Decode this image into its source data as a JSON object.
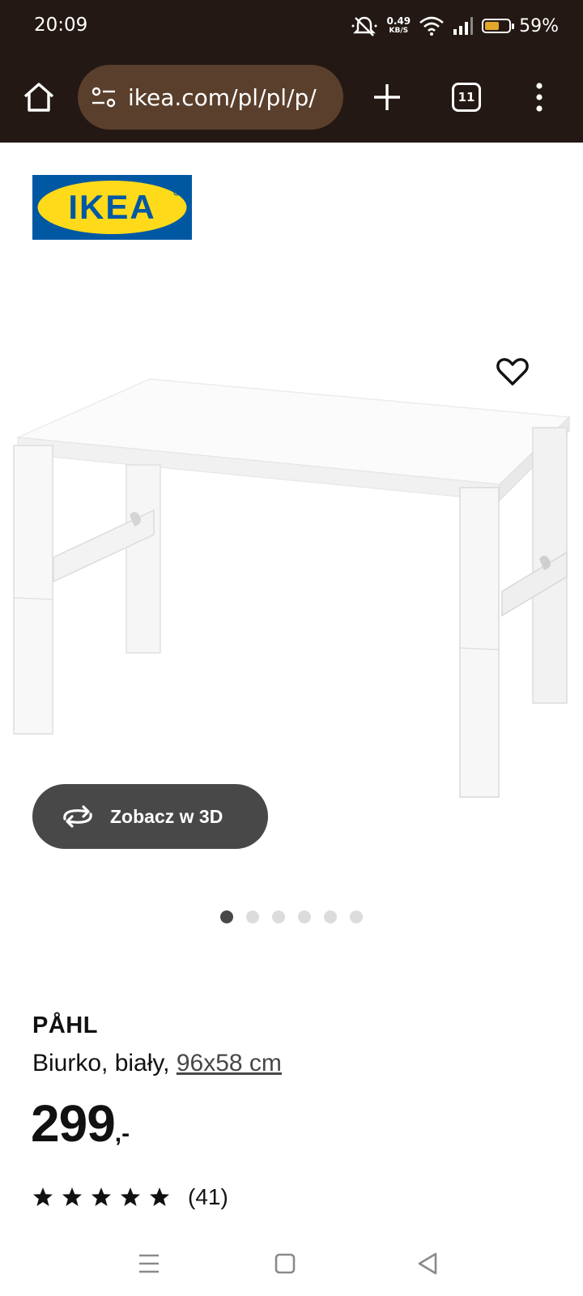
{
  "status_bar": {
    "time": "20:09",
    "net_speed_value": "0.49",
    "net_speed_unit": "KB/S",
    "battery_percent": "59%",
    "battery_level": 0.59,
    "icons": [
      "mute-icon",
      "wifi-icon",
      "signal-icon",
      "battery-icon"
    ]
  },
  "browser": {
    "url": "ikea.com/pl/pl/p/",
    "tab_count": "11",
    "icons": [
      "home-icon",
      "site-settings-icon",
      "new-tab-icon",
      "tabs-icon",
      "more-menu-icon"
    ]
  },
  "logo": {
    "text": "IKEA",
    "colors": {
      "blue": "#0058a3",
      "yellow": "#ffda1a"
    }
  },
  "gallery": {
    "view_3d_label": "Zobacz w 3D",
    "image_count": 6,
    "active_index": 0
  },
  "product": {
    "name": "PÅHL",
    "description_prefix": "Biurko, biały, ",
    "size_link": "96x58 cm",
    "price_main": "299",
    "price_suffix": ",-",
    "rating": 5,
    "rating_max": 5,
    "review_count": "(41)"
  },
  "colors": {
    "topbar": "#231813",
    "url_pill": "#5a3f2c",
    "button_dark": "#484848"
  },
  "system_nav": {
    "icons": [
      "recents-icon",
      "home-square-icon",
      "back-icon"
    ]
  }
}
